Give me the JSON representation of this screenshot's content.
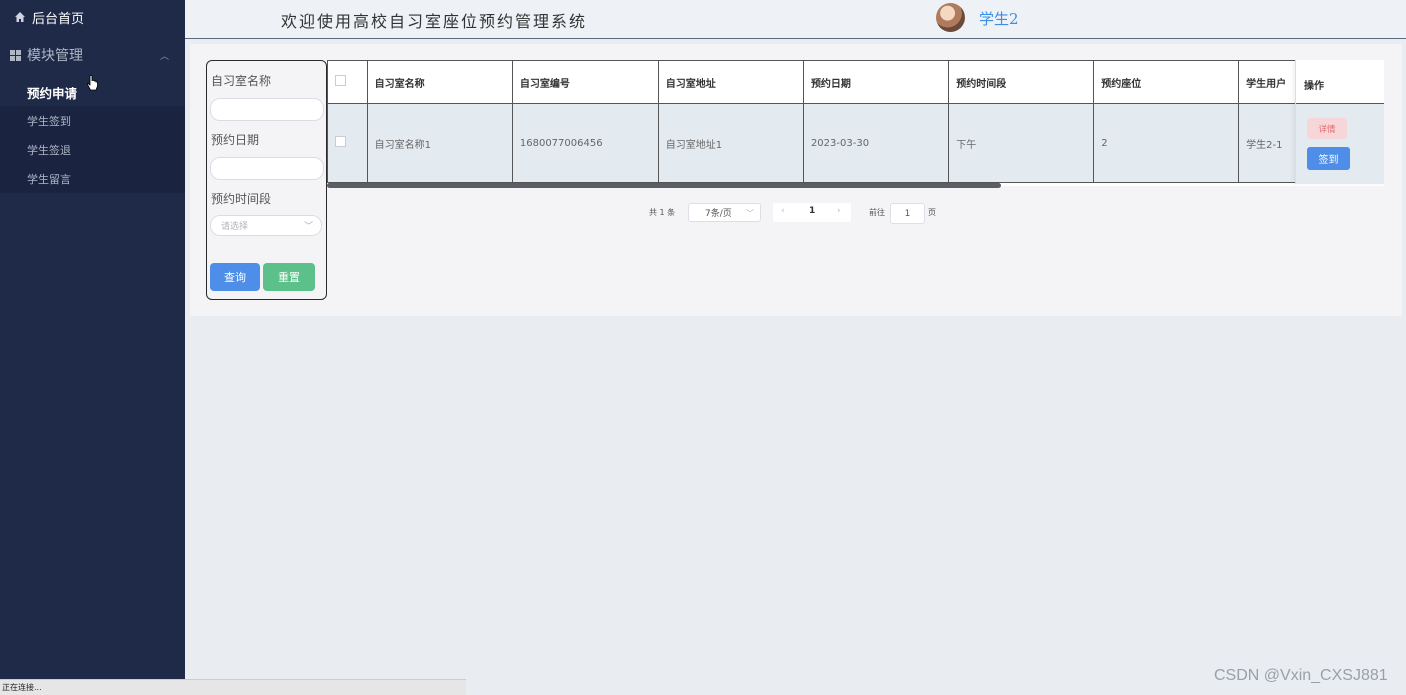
{
  "sidebar": {
    "home_label": "后台首页",
    "group_label": "模块管理",
    "items": [
      {
        "label": "预约申请",
        "active": true
      },
      {
        "label": "学生签到"
      },
      {
        "label": "学生签退"
      },
      {
        "label": "学生留言"
      }
    ]
  },
  "header": {
    "title": "欢迎使用高校自习室座位预约管理系统",
    "username": "学生2"
  },
  "filter": {
    "room_name_label": "自习室名称",
    "room_name_value": "",
    "date_label": "预约日期",
    "date_value": "",
    "time_slot_label": "预约时间段",
    "time_slot_placeholder": "请选择",
    "query_label": "查询",
    "reset_label": "重置"
  },
  "table": {
    "columns": [
      "自习室名称",
      "自习室编号",
      "自习室地址",
      "预约日期",
      "预约时间段",
      "预约座位",
      "学生用户"
    ],
    "ops_header": "操作",
    "rows": [
      {
        "cells": [
          "自习室名称1",
          "1680077006456",
          "自习室地址1",
          "2023-03-30",
          "下午",
          "2",
          "学生2-1"
        ],
        "detail_label": "详情",
        "sign_label": "签到"
      }
    ]
  },
  "pagination": {
    "total_text": "共 1 条",
    "page_size": "7条/页",
    "current_page": "1",
    "goto_prefix": "前往",
    "goto_value": "1",
    "goto_suffix": "页"
  },
  "status_bar": "正在连接...",
  "watermark": "CSDN @Vxin_CXSJ881",
  "colors": {
    "sidebar_bg": "#1f2a48",
    "primary": "#4f8ee8",
    "success": "#5cc08a",
    "danger_light": "#f6d6d8",
    "username": "#3a8ee6"
  }
}
